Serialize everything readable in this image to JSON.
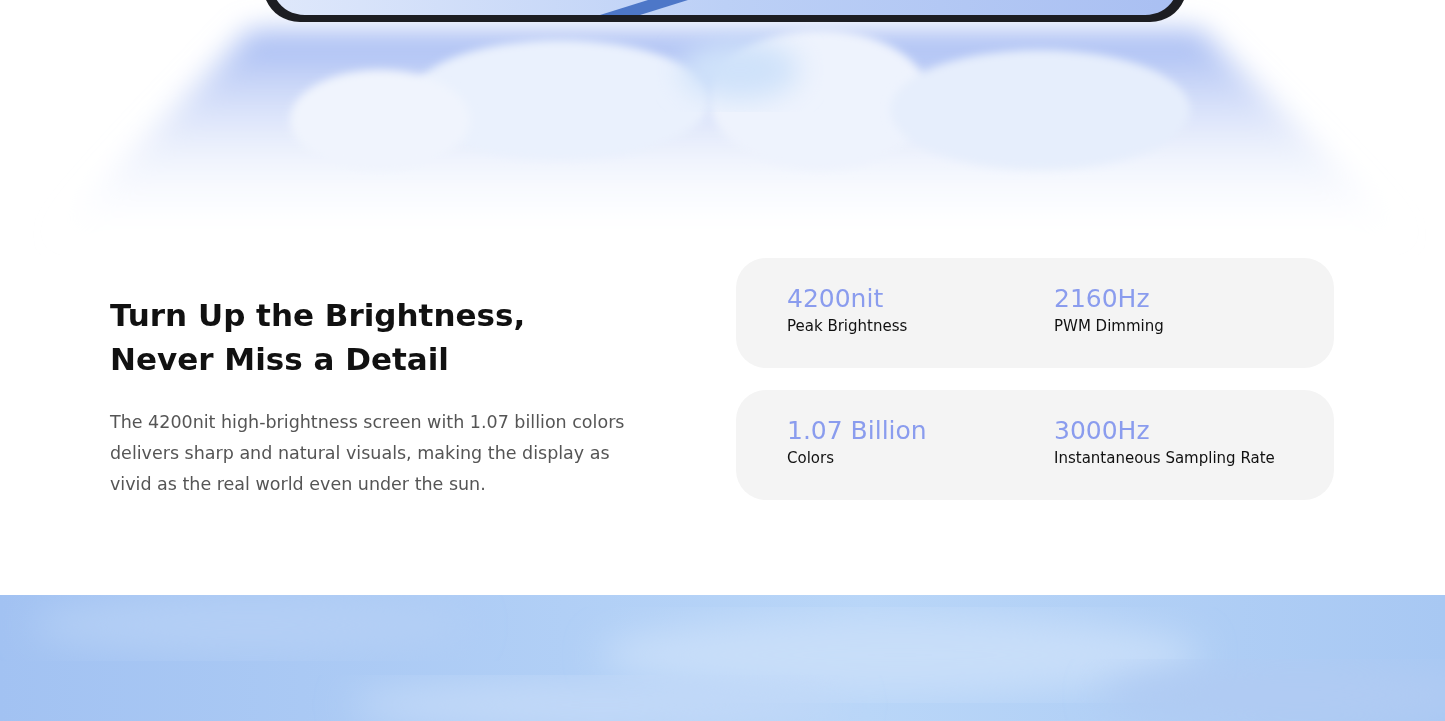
{
  "feature": {
    "heading_lines": [
      "Turn Up the Brightness,",
      "Never Miss a Detail"
    ],
    "body": "The 4200nit high-brightness screen with 1.07 billion colors delivers sharp and natural visuals, making the display as vivid as the real world even under the sun."
  },
  "stat_cards": [
    {
      "stats": [
        {
          "value": "4200nit",
          "label": "Peak Brightness"
        },
        {
          "value": "2160Hz",
          "label": "PWM Dimming"
        }
      ]
    },
    {
      "stats": [
        {
          "value": "1.07 Billion",
          "label": "Colors"
        },
        {
          "value": "3000Hz",
          "label": "Instantaneous Sampling Rate"
        }
      ]
    }
  ]
}
